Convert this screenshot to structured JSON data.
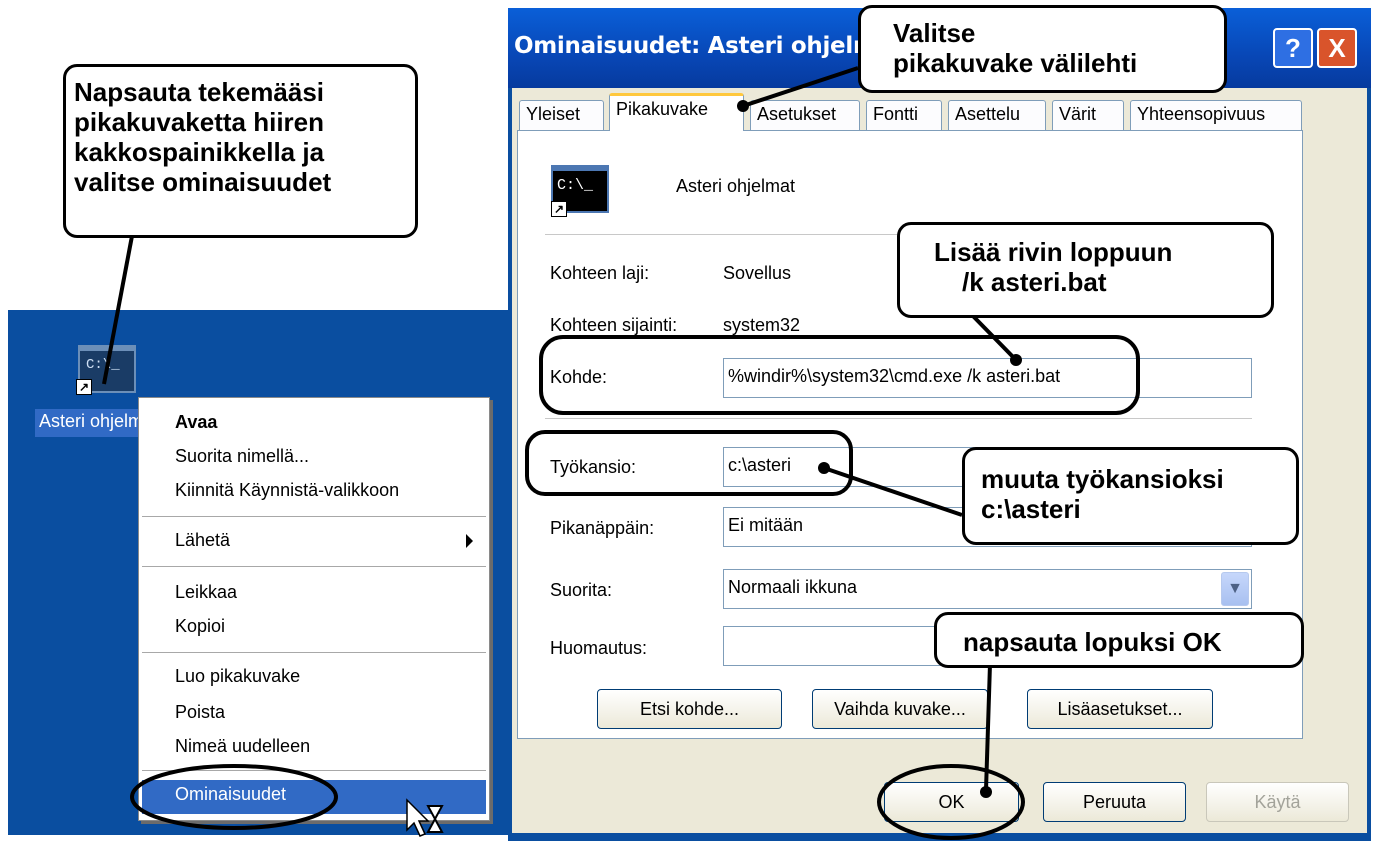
{
  "desktop": {
    "icon_label": "Asteri ohjelmat",
    "icon_screen_text": "C:\\_"
  },
  "context_menu": {
    "items": [
      "Avaa",
      "Suorita nimellä...",
      "Kiinnitä Käynnistä-valikkoon",
      "Lähetä",
      "Leikkaa",
      "Kopioi",
      "Luo pikakuvake",
      "Poista",
      "Nimeä uudelleen",
      "Ominaisuudet"
    ],
    "selected": "Ominaisuudet"
  },
  "dialog": {
    "title": "Ominaisuudet: Asteri ohjelmat",
    "help_glyph": "?",
    "close_glyph": "X",
    "tabs": [
      "Yleiset",
      "Pikakuvake",
      "Asetukset",
      "Fontti",
      "Asettelu",
      "Värit",
      "Yhteensopivuus"
    ],
    "active_tab": "Pikakuvake",
    "shortcut_name": "Asteri ohjelmat",
    "icon_text": "C:\\_",
    "target_type_label": "Kohteen laji:",
    "target_type_value": "Sovellus",
    "target_location_label": "Kohteen sijainti:",
    "target_location_value": "system32",
    "target_label": "Kohde:",
    "target_value": "%windir%\\system32\\cmd.exe /k asteri.bat",
    "start_in_label": "Työkansio:",
    "start_in_value": "c:\\asteri",
    "hotkey_label": "Pikanäppäin:",
    "hotkey_value": "Ei mitään",
    "run_label": "Suorita:",
    "run_value": "Normaali ikkuna",
    "comment_label": "Huomautus:",
    "comment_value": "",
    "buttons": {
      "find_target": "Etsi kohde...",
      "change_icon": "Vaihda kuvake...",
      "advanced": "Lisäasetukset...",
      "ok": "OK",
      "cancel": "Peruuta",
      "apply": "Käytä"
    }
  },
  "callouts": {
    "right_click": [
      "Napsauta tekemääsi",
      "pikakuvaketta hiiren",
      "kakkospainikkella ja",
      "valitse ominaisuudet"
    ],
    "select_tab": [
      "Valitse",
      "pikakuvake välilehti"
    ],
    "append": [
      "Lisää rivin loppuun",
      "/k asteri.bat"
    ],
    "workdir": [
      "muuta työkansioksi",
      "c:\\asteri"
    ],
    "ok": [
      "napsauta lopuksi OK"
    ]
  },
  "colors": {
    "desktop_blue": "#0a4ea0",
    "selection_blue": "#316ac5",
    "dialog_face": "#ece9d8"
  }
}
